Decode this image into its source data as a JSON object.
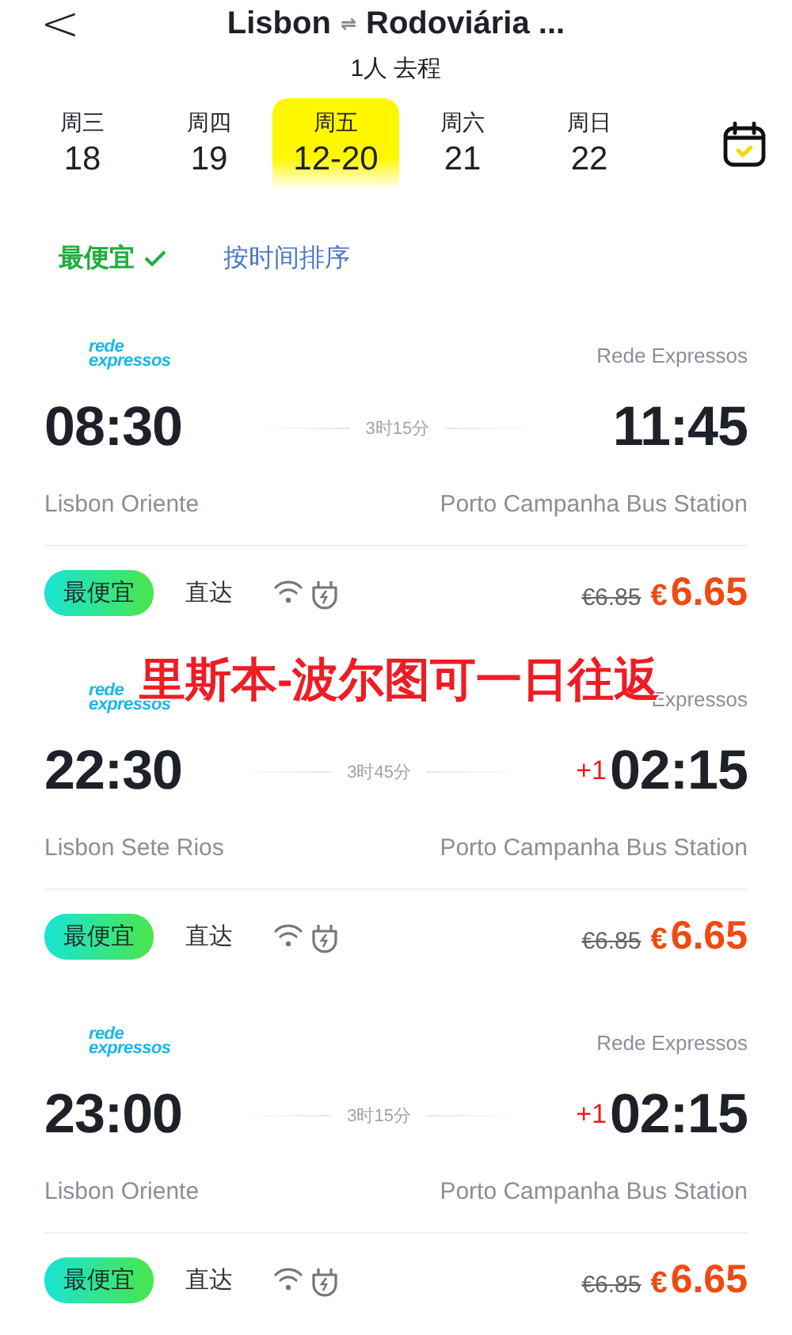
{
  "header": {
    "back": "<",
    "title": "Lisbon",
    "swap": "⇌",
    "destination": "Rodoviária ...",
    "subtitle": "1人 去程"
  },
  "dates": [
    {
      "weekday": "周三",
      "date": "18",
      "selected": false
    },
    {
      "weekday": "周四",
      "date": "19",
      "selected": false
    },
    {
      "weekday": "周五",
      "date": "12-20",
      "selected": true
    },
    {
      "weekday": "周六",
      "date": "21",
      "selected": false
    },
    {
      "weekday": "周日",
      "date": "22",
      "selected": false
    }
  ],
  "sort_options": [
    {
      "label": "最便宜",
      "selected": true
    },
    {
      "label": "按时间排序",
      "selected": false
    }
  ],
  "trips": [
    {
      "logo": [
        "rede",
        "expressos"
      ],
      "operator": "Rede Expressos",
      "depart": "08:30",
      "duration": "3时15分",
      "arrive": "11:45",
      "from": "Lisbon Oriente",
      "to": "Porto Campanha Bus Station",
      "tag": "最便宜",
      "direct": "直达",
      "old_price": "€6.85",
      "currency": "€",
      "price": "6.65"
    },
    {
      "logo": [
        "rede",
        "expressos"
      ],
      "operator": "Expressos",
      "depart": "22:30",
      "duration": "3时45分",
      "next_day": "+1",
      "arrive": "02:15",
      "from": "Lisbon Sete Rios",
      "to": "Porto Campanha Bus Station",
      "tag": "最便宜",
      "direct": "直达",
      "old_price": "€6.85",
      "currency": "€",
      "price": "6.65"
    },
    {
      "logo": [
        "rede",
        "expressos"
      ],
      "operator": "Rede Expressos",
      "depart": "23:00",
      "duration": "3时15分",
      "next_day": "+1",
      "arrive": "02:15",
      "from": "Lisbon Oriente",
      "to": "Porto Campanha Bus Station",
      "tag": "最便宜",
      "direct": "直达",
      "old_price": "€6.85",
      "currency": "€",
      "price": "6.65"
    }
  ],
  "overlay_caption": "里斯本-波尔图可一日往返"
}
